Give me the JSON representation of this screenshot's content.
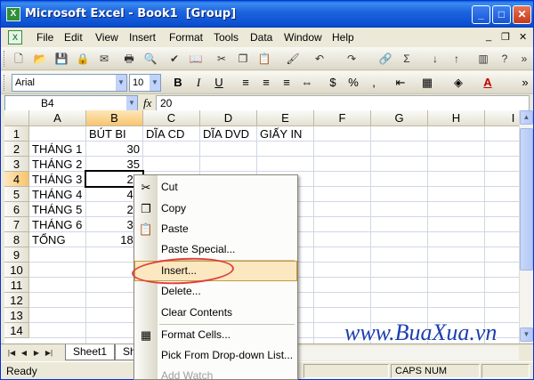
{
  "window": {
    "title": "Microsoft Excel - Book1  [Group]",
    "app_icon": "X",
    "min_label": "_",
    "max_label": "□",
    "close_label": "✕"
  },
  "menu": {
    "items": [
      "File",
      "Edit",
      "View",
      "Insert",
      "Format",
      "Tools",
      "Data",
      "Window",
      "Help"
    ],
    "doc_min": "_",
    "doc_restore": "❐",
    "doc_close": "✕"
  },
  "toolbar": {
    "font_name": "Arial",
    "font_size": "10",
    "bold": "B",
    "italic": "I",
    "underline": "U",
    "currency": "$",
    "percent": "%",
    "font_color_label": "A"
  },
  "formula_bar": {
    "name_box": "B4",
    "fx": "fx",
    "value": "20"
  },
  "grid": {
    "columns": [
      "A",
      "B",
      "C",
      "D",
      "E",
      "F",
      "G",
      "H",
      "I"
    ],
    "rows": [
      "1",
      "2",
      "3",
      "4",
      "5",
      "6",
      "7",
      "8",
      "9",
      "10",
      "11",
      "12",
      "13",
      "14"
    ],
    "cells": {
      "B1": "BÚT BI",
      "C1": "DĨA CD",
      "D1": "DĨA DVD",
      "E1": "GIẤY IN",
      "A2": "THÁNG 1",
      "B2": "30",
      "A3": "THÁNG 2",
      "B3": "35",
      "A4": "THÁNG 3",
      "B4": "20",
      "A5": "THÁNG 4",
      "B5": "45",
      "A6": "THÁNG 5",
      "B6": "25",
      "A7": "THÁNG 6",
      "B7": "35",
      "A8": "TỔNG",
      "B8": "185"
    },
    "selected_cell": "B4"
  },
  "context_menu": {
    "items": [
      {
        "label": "Cut",
        "icon": "scissors-icon",
        "glyph": "✂",
        "disabled": false
      },
      {
        "label": "Copy",
        "icon": "copy-icon",
        "glyph": "❐",
        "disabled": false
      },
      {
        "label": "Paste",
        "icon": "paste-icon",
        "glyph": "📋",
        "disabled": false
      },
      {
        "label": "Paste Special...",
        "icon": "",
        "glyph": "",
        "disabled": false
      },
      {
        "label": "Insert...",
        "icon": "",
        "glyph": "",
        "disabled": false,
        "highlighted": true
      },
      {
        "label": "Delete...",
        "icon": "",
        "glyph": "",
        "disabled": false
      },
      {
        "label": "Clear Contents",
        "icon": "",
        "glyph": "",
        "disabled": false
      },
      {
        "label": "Format Cells...",
        "icon": "format-cells-icon",
        "glyph": "▦",
        "disabled": false
      },
      {
        "label": "Pick From Drop-down List...",
        "icon": "",
        "glyph": "",
        "disabled": false
      },
      {
        "label": "Add Watch",
        "icon": "",
        "glyph": "",
        "disabled": true
      }
    ]
  },
  "sheets": {
    "tabs": [
      "Sheet1",
      "Sh"
    ]
  },
  "status": {
    "text": "Ready",
    "caps": "CAPS NUM"
  },
  "watermark": "www.BuaXua.vn",
  "colors": {
    "title_bar": "#0a4fd0",
    "highlight": "#fbe8c0",
    "ring": "#e04040",
    "watermark": "#1d3fae"
  }
}
